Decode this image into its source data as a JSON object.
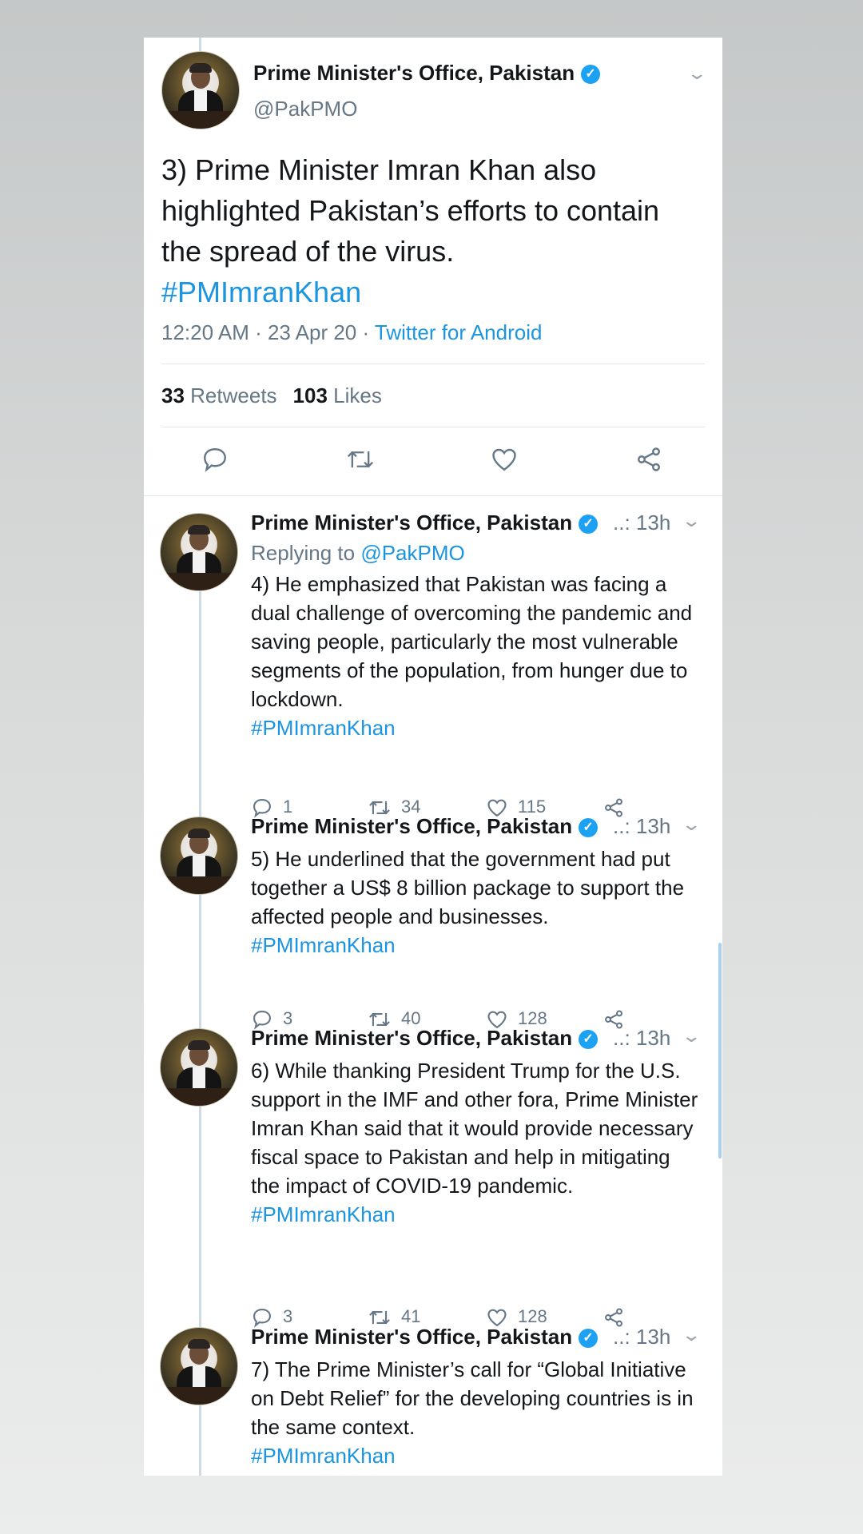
{
  "main_tweet": {
    "author_name": "Prime Minister's Office, Pakistan",
    "handle": "@PakPMO",
    "text": "3) Prime Minister Imran Khan also highlighted Pakistan’s efforts to contain the spread of the virus.",
    "hashtag": "#PMImranKhan",
    "time": "12:20 AM · 23 Apr 20 · ",
    "source": "Twitter for Android",
    "retweets_count": "33",
    "retweets_label": "Retweets",
    "likes_count": "103",
    "likes_label": "Likes"
  },
  "replies": [
    {
      "author_name": "Prime Minister's Office, Pakistan",
      "time": "..: 13h",
      "replying_to_label": "Replying to ",
      "replying_to_handle": "@PakPMO",
      "text": "4) He emphasized that Pakistan was facing a dual challenge of overcoming the pandemic and saving people, particularly the most vulnerable segments of the population, from hunger due to lockdown.",
      "hashtag": "#PMImranKhan",
      "reply_count": "1",
      "retweet_count": "34",
      "like_count": "115"
    },
    {
      "author_name": "Prime Minister's Office, Pakistan",
      "time": "..: 13h",
      "text": "5) He underlined that the government had put together a US$ 8 billion package to support the affected people and businesses.",
      "hashtag": "#PMImranKhan",
      "reply_count": "3",
      "retweet_count": "40",
      "like_count": "128"
    },
    {
      "author_name": "Prime Minister's Office, Pakistan",
      "time": "..: 13h",
      "text": "6) While thanking President Trump for the U.S. support in the IMF and other fora, Prime Minister Imran Khan said that it would provide necessary fiscal space to Pakistan and help in mitigating the impact of COVID-19 pandemic.",
      "hashtag": "#PMImranKhan",
      "reply_count": "3",
      "retweet_count": "41",
      "like_count": "128"
    },
    {
      "author_name": "Prime Minister's Office, Pakistan",
      "time": "..: 13h",
      "text": "7) The Prime Minister’s call for “Global Initiative on Debt Relief” for the developing countries is in the same context.",
      "hashtag": "#PMImranKhan"
    }
  ],
  "colors": {
    "link": "#1b95e0",
    "verified": "#1da1f2",
    "secondary_text": "#657786"
  },
  "icons": [
    "verified-badge-icon",
    "chevron-down-icon",
    "reply-icon",
    "retweet-icon",
    "like-icon",
    "share-icon"
  ]
}
